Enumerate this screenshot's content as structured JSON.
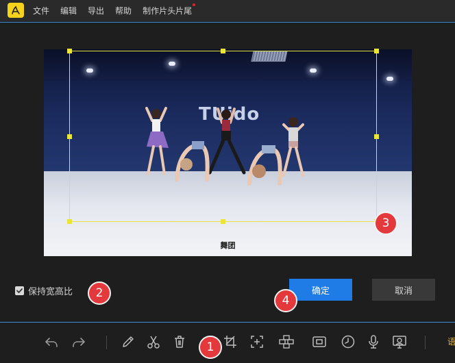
{
  "menu": {
    "items": [
      "文件",
      "编辑",
      "导出",
      "帮助",
      "制作片头片尾"
    ],
    "new_badge_color": "#e02424"
  },
  "preview": {
    "brand_text": "TUido",
    "subtitle": "舞团"
  },
  "options": {
    "keep_aspect_ratio_label": "保持宽高比",
    "keep_aspect_ratio_checked": true
  },
  "buttons": {
    "ok_label": "确定",
    "cancel_label": "取消"
  },
  "badges": [
    "1",
    "2",
    "3",
    "4"
  ],
  "toolbar": {
    "tools": [
      "undo-icon",
      "redo-icon",
      "pencil-icon",
      "scissors-icon",
      "trash-icon",
      "crop-icon",
      "zoom-frame-icon",
      "mosaic-icon",
      "screen-fit-icon",
      "clock-icon",
      "microphone-icon",
      "voiceover-icon"
    ],
    "extra_label": "语"
  },
  "colors": {
    "accent_blue": "#1f7be6",
    "crop_yellow": "#e6e33a",
    "badge_red": "#e4393c",
    "logo_yellow": "#f7d21c"
  }
}
